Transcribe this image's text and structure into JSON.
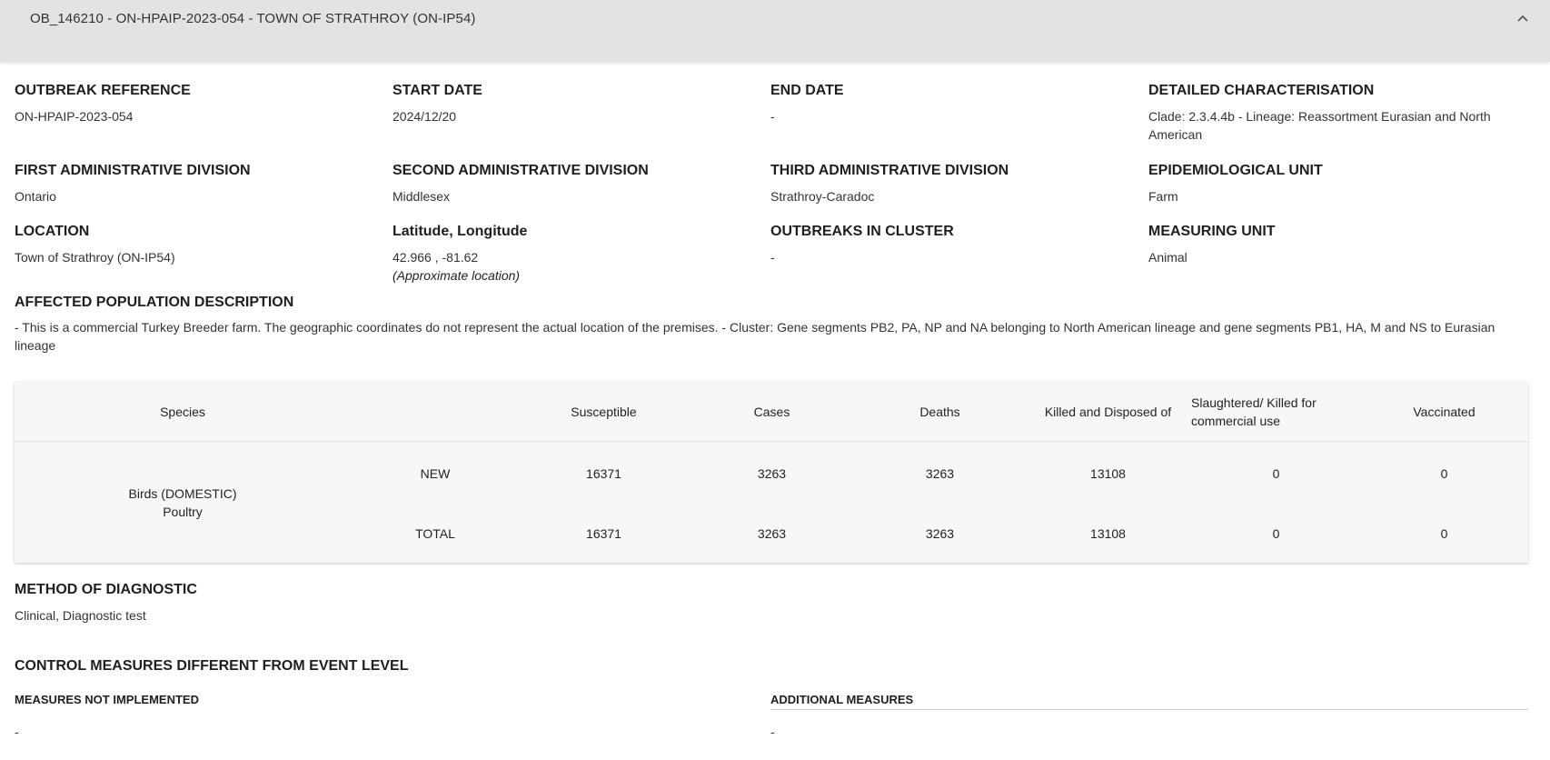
{
  "header": {
    "title": "OB_146210 - ON-HPAIP-2023-054 - TOWN OF STRATHROY (ON-IP54)"
  },
  "fields": {
    "outbreak_reference": {
      "label": "OUTBREAK REFERENCE",
      "value": "ON-HPAIP-2023-054"
    },
    "start_date": {
      "label": "START DATE",
      "value": "2024/12/20"
    },
    "end_date": {
      "label": "END DATE",
      "value": "-"
    },
    "detailed_characterisation": {
      "label": "DETAILED CHARACTERISATION",
      "value": "Clade: 2.3.4.4b - Lineage: Reassortment Eurasian and North American"
    },
    "first_admin": {
      "label": "FIRST ADMINISTRATIVE DIVISION",
      "value": "Ontario"
    },
    "second_admin": {
      "label": "SECOND ADMINISTRATIVE DIVISION",
      "value": "Middlesex"
    },
    "third_admin": {
      "label": "THIRD ADMINISTRATIVE DIVISION",
      "value": "Strathroy-Caradoc"
    },
    "epi_unit": {
      "label": "EPIDEMIOLOGICAL UNIT",
      "value": "Farm"
    },
    "location": {
      "label": "LOCATION",
      "value": "Town of Strathroy (ON-IP54)"
    },
    "lat_long": {
      "label": "Latitude, Longitude",
      "value": "42.966 , -81.62",
      "note": "(Approximate location)"
    },
    "outbreaks_in_cluster": {
      "label": "OUTBREAKS IN CLUSTER",
      "value": "-"
    },
    "measuring_unit": {
      "label": "MEASURING UNIT",
      "value": "Animal"
    }
  },
  "affected_population": {
    "label": "AFFECTED POPULATION DESCRIPTION",
    "value": "- This is a commercial Turkey Breeder farm. The geographic coordinates do not represent the actual location of the premises. - Cluster: Gene segments PB2, PA, NP and NA belonging to North American lineage and gene segments PB1, HA, M and NS to Eurasian lineage"
  },
  "table": {
    "headers": {
      "species": "Species",
      "susceptible": "Susceptible",
      "cases": "Cases",
      "deaths": "Deaths",
      "killed": "Killed and Disposed of",
      "slaughtered": "Slaughtered/ Killed for commercial use",
      "vaccinated": "Vaccinated"
    },
    "species_line1": "Birds (DOMESTIC)",
    "species_line2": "Poultry",
    "rows": [
      {
        "kind": "NEW",
        "susceptible": "16371",
        "cases": "3263",
        "deaths": "3263",
        "killed": "13108",
        "slaughtered": "0",
        "vaccinated": "0"
      },
      {
        "kind": "TOTAL",
        "susceptible": "16371",
        "cases": "3263",
        "deaths": "3263",
        "killed": "13108",
        "slaughtered": "0",
        "vaccinated": "0"
      }
    ]
  },
  "diagnostic": {
    "label": "METHOD OF DIAGNOSTIC",
    "value": "Clinical, Diagnostic test"
  },
  "control_measures": {
    "title": "CONTROL MEASURES DIFFERENT FROM EVENT LEVEL",
    "not_implemented_label": "MEASURES NOT IMPLEMENTED",
    "not_implemented_value": "-",
    "additional_label": "ADDITIONAL MEASURES",
    "additional_value": "-"
  },
  "icons": {
    "collapse": "chevron-up-icon"
  }
}
